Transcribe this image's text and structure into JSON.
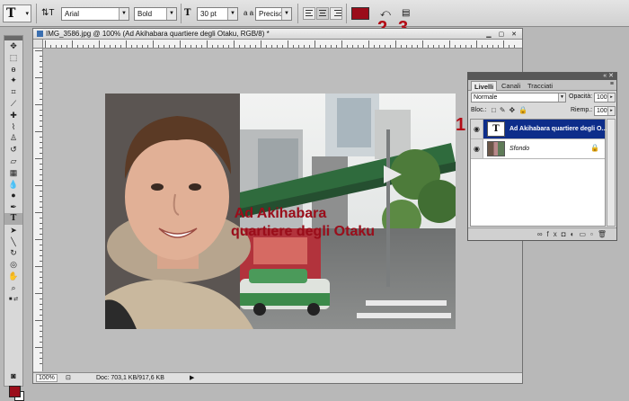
{
  "options_bar": {
    "tool_glyph": "T",
    "font_family": "Arial",
    "font_style": "Bold",
    "font_size": "30 pt",
    "antialias_label": "a a",
    "antialias": "Preciso",
    "text_color": "#9b0d1a"
  },
  "callouts": {
    "one": "1",
    "two": "2",
    "three": "3"
  },
  "document": {
    "title": "IMG_3586.jpg @ 100% (Ad Akihabara quartiere degli Otaku, RGB/8) *",
    "zoom": "100%",
    "doc_size": "Doc: 703,1 KB/917,6 KB",
    "overlay_line1": "Ad Akihabara",
    "overlay_line2": "quartiere degli Otaku"
  },
  "layers_panel": {
    "tabs": [
      "Livelli",
      "Canali",
      "Tracciati"
    ],
    "blend_mode": "Normale",
    "opacity_label": "Opacità:",
    "opacity": "100%",
    "lock_label": "Bloc.:",
    "fill_label": "Riemp.:",
    "fill": "100%",
    "layers": [
      {
        "name": "Ad Akihabara quartiere degli O...",
        "kind": "text",
        "selected": true
      },
      {
        "name": "Sfondo",
        "kind": "image",
        "locked": true
      }
    ]
  },
  "colors": {
    "foreground": "#9b0d1a",
    "background": "#ffffff",
    "selection": "#0d2d8a"
  }
}
